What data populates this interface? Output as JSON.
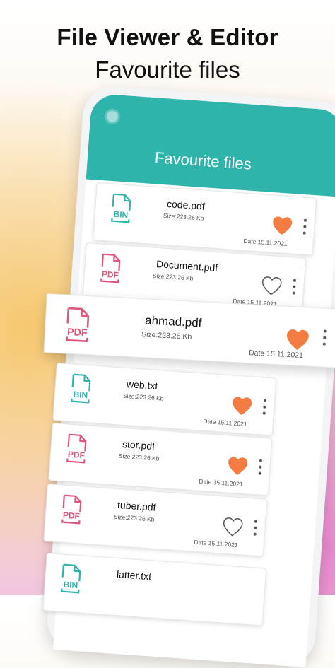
{
  "promo": {
    "headline": "File Viewer & Editor",
    "subline": "Favourite files"
  },
  "app": {
    "title": "Favourite files"
  },
  "colors": {
    "app_bar": "#2fb4ac",
    "bin_icon": "#2fb4ac",
    "pdf_icon": "#e0557a",
    "heart_filled": "#f47c42",
    "heart_outline": "#555555"
  },
  "files": [
    {
      "name": "code.pdf",
      "size": "Size:223.26 Kb",
      "date": "Date 15.11.2021",
      "icon": "bin-file-icon",
      "favourite": true
    },
    {
      "name": "Document.pdf",
      "size": "Size:223.26 Kb",
      "date": "Date 15.11.2021",
      "icon": "pdf-file-icon",
      "favourite": false
    },
    {
      "name": "ahmad.pdf",
      "size": "Size:223.26 Kb",
      "date": "Date 15.11.2021",
      "icon": "pdf-file-icon",
      "favourite": true
    },
    {
      "name": "web.txt",
      "size": "Size:223.26 Kb",
      "date": "Date 15.11.2021",
      "icon": "bin-file-icon",
      "favourite": true
    },
    {
      "name": "stor.pdf",
      "size": "Size:223.26 Kb",
      "date": "Date 15.11.2021",
      "icon": "pdf-file-icon",
      "favourite": true
    },
    {
      "name": "tuber.pdf",
      "size": "Size:223.26 Kb",
      "date": "Date 15.11.2021",
      "icon": "pdf-file-icon",
      "favourite": false
    },
    {
      "name": "latter.txt",
      "size": "",
      "date": "",
      "icon": "bin-file-icon",
      "favourite": false
    }
  ]
}
